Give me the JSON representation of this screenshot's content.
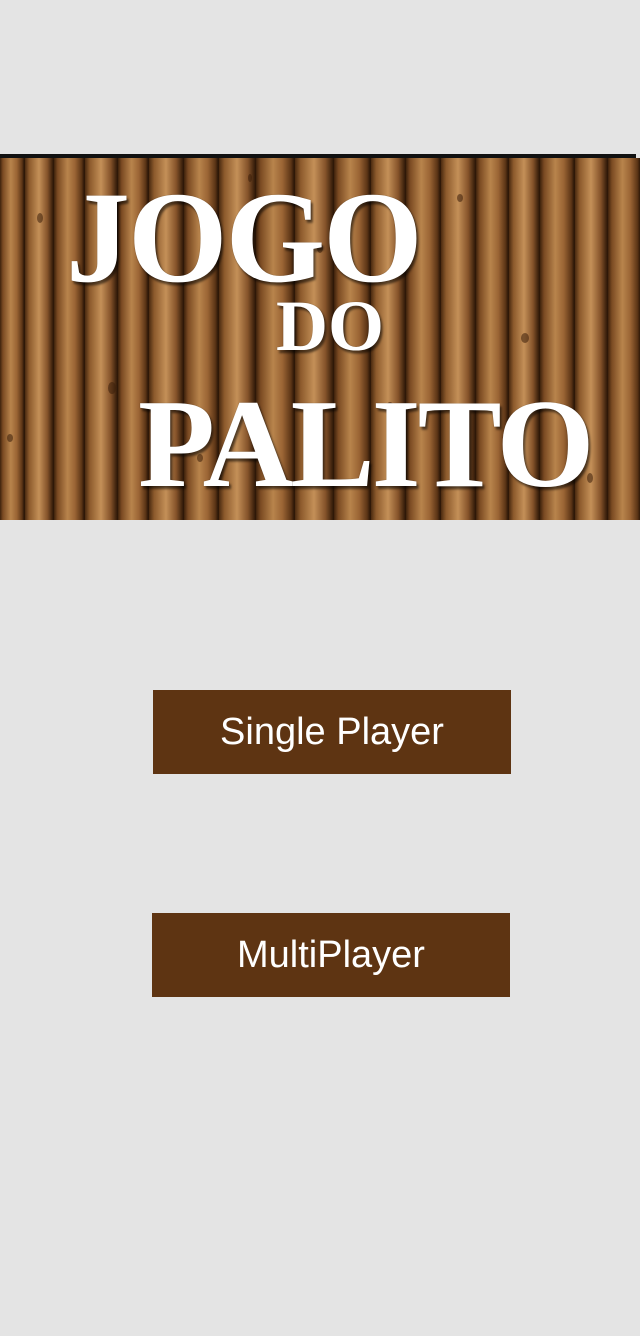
{
  "banner": {
    "title_line1": "JOGO",
    "title_line2": "DO",
    "title_line3": "PALITO"
  },
  "menu": {
    "single_player_label": "Single Player",
    "multiplayer_label": "MultiPlayer"
  },
  "colors": {
    "background": "#e4e4e4",
    "button": "#5e3412",
    "button_text": "#ffffff",
    "wood_dark": "#5a3315",
    "wood_light": "#b07a45"
  }
}
